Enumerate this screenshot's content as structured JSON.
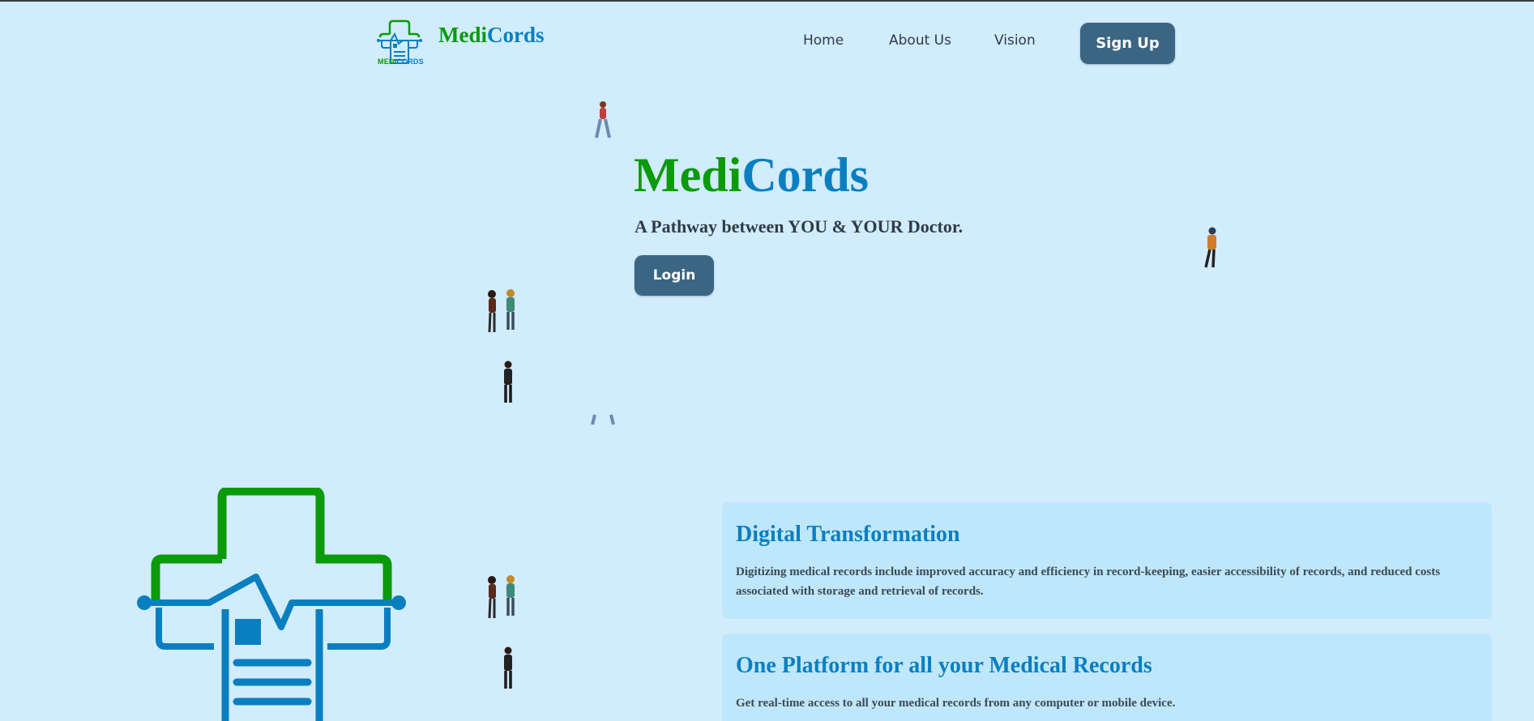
{
  "nav": {
    "logo_caption_a": "MEDI",
    "logo_caption_b": "CORDS",
    "brand_a": "Medi",
    "brand_b": "Cords",
    "links": [
      "Home",
      "About Us",
      "Vision"
    ],
    "signup_label": "Sign Up"
  },
  "hero": {
    "title_a": "Medi",
    "title_b": "Cords",
    "subtitle": "A Pathway between YOU & YOUR Doctor.",
    "login_label": "Login"
  },
  "cards": [
    {
      "title": "Digital Transformation",
      "text": "Digitizing medical records include improved accuracy and efficiency in record-keeping, easier accessibility of records, and reduced costs associated with storage and retrieval of records."
    },
    {
      "title": "One Platform for all your Medical Records",
      "text": "Get real-time access to all your medical records from any computer or mobile device."
    }
  ],
  "colors": {
    "background": "#d1ecfd",
    "brand_green": "#0a9a0a",
    "brand_blue": "#0a7fc0",
    "button": "#3b6683",
    "card": "#bfe7fb"
  },
  "icons": [
    "medicords-logo-icon",
    "person-figure-icon"
  ]
}
